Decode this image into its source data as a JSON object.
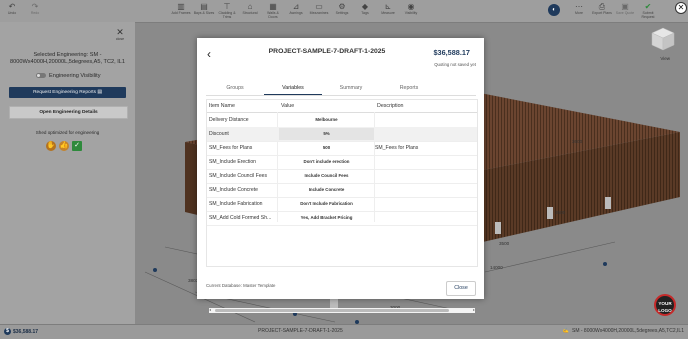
{
  "toolbar": {
    "items": [
      {
        "label": "Undo",
        "icon": "undo-icon"
      },
      {
        "label": "Redo",
        "icon": "redo-icon"
      },
      {
        "label": "Add Frames",
        "icon": "frame-icon"
      },
      {
        "label": "Bays & Sizes",
        "icon": "bays-icon"
      },
      {
        "label": "Cladding & Trims",
        "icon": "cladding-icon"
      },
      {
        "label": "Structural",
        "icon": "structural-icon"
      },
      {
        "label": "Walls & Doors",
        "icon": "walls-icon"
      },
      {
        "label": "Awnings",
        "icon": "awnings-icon"
      },
      {
        "label": "Mezzanines",
        "icon": "mezzanine-icon"
      },
      {
        "label": "Settings",
        "icon": "settings-icon"
      },
      {
        "label": "Tags",
        "icon": "tag-icon"
      },
      {
        "label": "Measure",
        "icon": "measure-icon"
      },
      {
        "label": "Visibility",
        "icon": "eye-icon"
      }
    ],
    "right_items": [
      {
        "label": "More",
        "icon": "more-icon"
      },
      {
        "label": "Export Plans",
        "icon": "print-icon"
      },
      {
        "label": "Save Quote",
        "icon": "save-icon"
      },
      {
        "label": "Submit Request",
        "icon": "check-icon"
      }
    ]
  },
  "left_panel": {
    "close_label": "close",
    "selected_engineering": "Selected Engineering: SM - 8000Wx4000H,20000L,5degrees,A5, TC2, IL1",
    "engineering_visibility": "Engineering Visibility",
    "request_reports_button": "Request Engineering Reports",
    "open_details_button": "Open Engineering Details",
    "shed_optimized": "Shed optimized for engineering"
  },
  "scene": {
    "view_label": "View",
    "logo_text_1": "YOUR",
    "logo_text_2": "LOGO",
    "dimensions": [
      "3600",
      "3500",
      "3500",
      "3803",
      "14000",
      "3000",
      "3803"
    ]
  },
  "statusbar": {
    "price": "$36,588.17",
    "project": "PROJECT-SAMPLE-7-DRAFT-1-2025",
    "engineering": "SM - 8000Wx4000H,20000L,5degrees,A5,TC2,IL1"
  },
  "modal": {
    "title": "PROJECT-SAMPLE-7-DRAFT-1-2025",
    "price": "$36,588.17",
    "quote_status": "Quoting not saved yet",
    "tabs": [
      "Groups",
      "Variables",
      "Summary",
      "Reports"
    ],
    "active_tab": "Variables",
    "columns": [
      "Item Name",
      "Value",
      "Description"
    ],
    "rows": [
      {
        "name": "Delivery Distance",
        "value": "Melbourne",
        "description": ""
      },
      {
        "name": "Discount",
        "value": "5%",
        "description": ""
      },
      {
        "name": "SM_Fees for Plans",
        "value": "500",
        "description": "SM_Fees for Plans"
      },
      {
        "name": "SM_Include Erection",
        "value": "Don't include erection",
        "description": ""
      },
      {
        "name": "SM_Include Council Fees",
        "value": "Include Council Fees",
        "description": ""
      },
      {
        "name": "SM_Include Concrete",
        "value": "Include Concrete",
        "description": ""
      },
      {
        "name": "SM_Include Fabrication",
        "value": "Don't Include Fabrication",
        "description": ""
      },
      {
        "name": "SM_Add Cold Formed Sh...",
        "value": "Yes, Add Bracket Pricing",
        "description": ""
      }
    ],
    "current_database": "Current Database: Master Template",
    "close_button": "Close"
  }
}
